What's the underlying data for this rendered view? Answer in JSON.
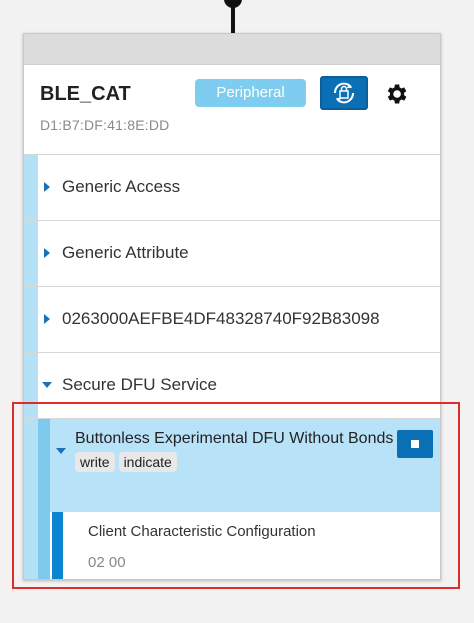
{
  "device": {
    "name": "BLE_CAT",
    "address": "D1:B7:DF:41:8E:DD",
    "role_badge": "Peripheral",
    "dfu_icon": "dfu-icon",
    "settings_icon": "gear-icon"
  },
  "services": [
    {
      "label": "Generic Access",
      "expanded": false
    },
    {
      "label": "Generic Attribute",
      "expanded": false
    },
    {
      "label": "0263000AEFBE4DF48328740F92B83098",
      "expanded": false
    },
    {
      "label": "Secure DFU Service",
      "expanded": true
    }
  ],
  "characteristic": {
    "label": "Buttonless Experimental DFU Without Bonds",
    "tags": [
      "write",
      "indicate"
    ],
    "notify_icon": "stop-icon"
  },
  "descriptor": {
    "label": "Client Characteristic Configuration",
    "value": "02 00"
  },
  "colors": {
    "accent": "#0a6fb5",
    "badge": "#7ecdf0",
    "selected_row": "#b8e2f8",
    "highlight_border": "#e02b2b"
  }
}
